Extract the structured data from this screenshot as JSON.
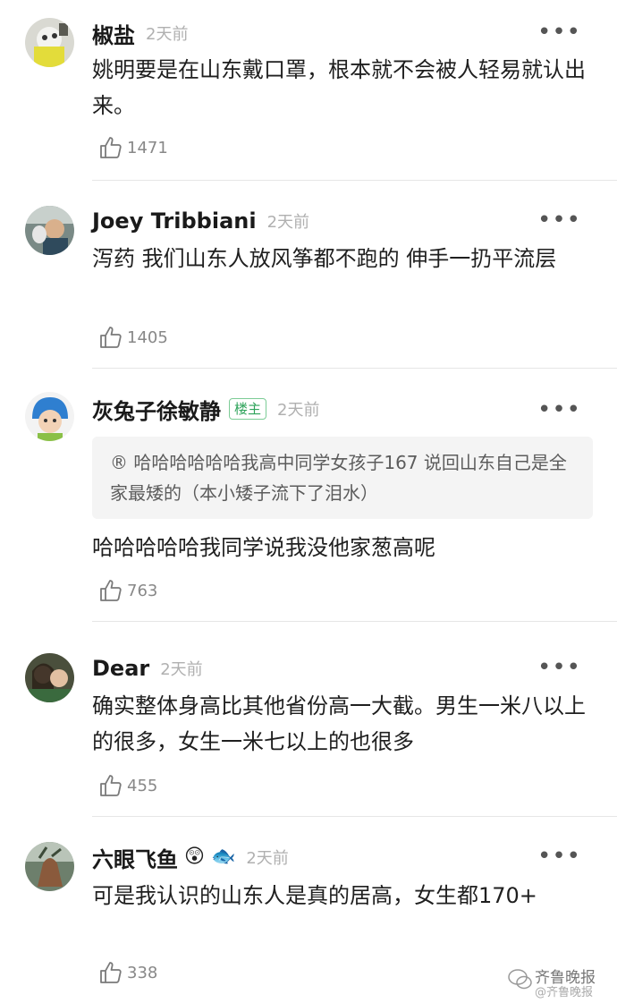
{
  "comments": [
    {
      "name": "椒盐",
      "time": "2天前",
      "text": "姚明要是在山东戴口罩，根本就不会被人轻易就认出来。",
      "likes": "1471"
    },
    {
      "name": "Joey Tribbiani",
      "time": "2天前",
      "text": "泻药 我们山东人放风筝都不跑的 伸手一扔平流层",
      "likes": "1405"
    },
    {
      "name": "灰兔子徐敏静",
      "badge": "楼主",
      "time": "2天前",
      "quote": "® 哈哈哈哈哈哈我高中同学女孩子167 说回山东自己是全家最矮的（本小矮子流下了泪水）",
      "text": "哈哈哈哈哈我同学说我没他家葱高呢",
      "likes": "763"
    },
    {
      "name": "Dear",
      "time": "2天前",
      "text": "确实整体身高比其他省份高一大截。男生一米八以上的很多，女生一米七以上的也很多",
      "likes": "455"
    },
    {
      "name": "六眼飞鱼",
      "emoji1": "😲",
      "emoji2": "🐟",
      "time": "2天前",
      "text": "可是我认识的山东人是真的居高，女生都170+",
      "likes": "338"
    }
  ],
  "more_label": "•••",
  "watermark": {
    "brand": "齐鲁晚报",
    "sub": "@齐鲁晚报"
  }
}
